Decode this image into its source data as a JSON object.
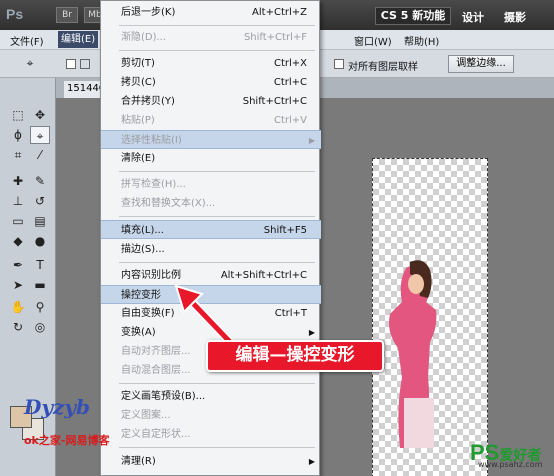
{
  "titlebar": {
    "app_logo": "Ps",
    "btn_br": "Br",
    "btn_mb": "Mb",
    "workspace_main": "CS 5 新功能",
    "workspace_items": [
      "设计",
      "摄影"
    ]
  },
  "menubar": {
    "items": [
      "文件(F)",
      "编辑(E)",
      "窗口(W)",
      "帮助(H)"
    ]
  },
  "options": {
    "sample_all_layers": "对所有图层取样",
    "refine_edge": "调整边缘..."
  },
  "tab": {
    "doc_label": "15144Q"
  },
  "dropdown": {
    "items": [
      {
        "label": "后退一步(K)",
        "shortcut": "Alt+Ctrl+Z",
        "disabled": false
      },
      {
        "label": "渐隐(D)...",
        "shortcut": "Shift+Ctrl+F",
        "disabled": true
      },
      {
        "label": "剪切(T)",
        "shortcut": "Ctrl+X",
        "disabled": false
      },
      {
        "label": "拷贝(C)",
        "shortcut": "Ctrl+C",
        "disabled": false
      },
      {
        "label": "合并拷贝(Y)",
        "shortcut": "Shift+Ctrl+C",
        "disabled": false
      },
      {
        "label": "粘贴(P)",
        "shortcut": "Ctrl+V",
        "disabled": true
      },
      {
        "label": "选择性粘贴(I)",
        "shortcut": "",
        "disabled": true,
        "submenu": true
      },
      {
        "label": "清除(E)",
        "shortcut": "",
        "disabled": false
      },
      {
        "label": "拼写检查(H)...",
        "shortcut": "",
        "disabled": true
      },
      {
        "label": "查找和替换文本(X)...",
        "shortcut": "",
        "disabled": true
      },
      {
        "label": "填充(L)...",
        "shortcut": "Shift+F5",
        "disabled": false
      },
      {
        "label": "描边(S)...",
        "shortcut": "",
        "disabled": false
      },
      {
        "label": "内容识别比例",
        "shortcut": "Alt+Shift+Ctrl+C",
        "disabled": false
      },
      {
        "label": "操控变形",
        "shortcut": "",
        "disabled": false
      },
      {
        "label": "自由变换(F)",
        "shortcut": "Ctrl+T",
        "disabled": false
      },
      {
        "label": "变换(A)",
        "shortcut": "",
        "disabled": false,
        "submenu": true
      },
      {
        "label": "自动对齐图层...",
        "shortcut": "",
        "disabled": true
      },
      {
        "label": "自动混合图层...",
        "shortcut": "",
        "disabled": true
      },
      {
        "label": "定义画笔预设(B)...",
        "shortcut": "",
        "disabled": false
      },
      {
        "label": "定义图案...",
        "shortcut": "",
        "disabled": true
      },
      {
        "label": "定义自定形状...",
        "shortcut": "",
        "disabled": true
      },
      {
        "label": "清理(R)",
        "shortcut": "",
        "disabled": false,
        "submenu": true
      }
    ]
  },
  "annotation": {
    "callout": "编辑—操控变形"
  },
  "watermarks": {
    "logo": "Dyzyb",
    "blog": "ok之家-网易博客",
    "ps_brand_big": "PS",
    "ps_brand": "爱好者",
    "url": "www.psahz.com"
  },
  "colors": {
    "foreground": "#ddc6a8",
    "background": "#e9e4dc",
    "callout_bg": "#e8182a",
    "highlight": "#c6d6ea"
  }
}
